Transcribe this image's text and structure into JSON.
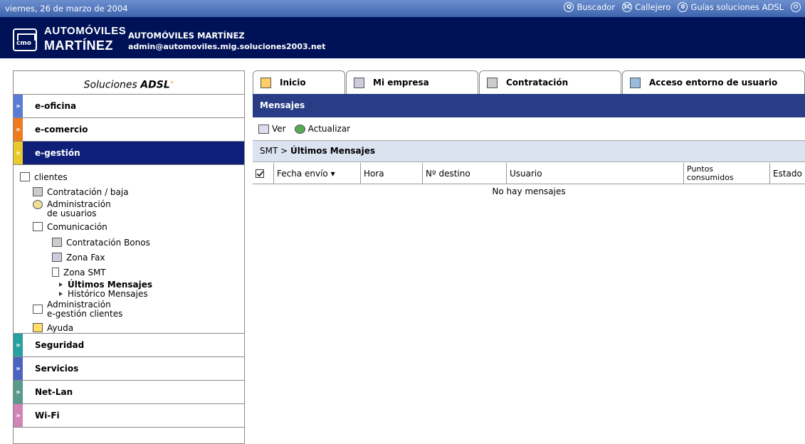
{
  "topbar": {
    "date": "viernes, 26 de marzo de 2004",
    "links": [
      {
        "label": "Buscador",
        "icon": "search-icon"
      },
      {
        "label": "Callejero",
        "icon": "map-icon"
      },
      {
        "label": "Guías soluciones ADSL",
        "icon": "guide-icon"
      }
    ],
    "power_icon": "power-icon"
  },
  "header": {
    "logo_line1": "AUTOMÓVILES",
    "logo_line2": "MARTÍNEZ",
    "logo_badge": "cmo",
    "company_name": "AUTOMÓVILES MARTÍNEZ",
    "company_email": "admin@automoviles.mig.soluciones2003.net"
  },
  "sidebar": {
    "title_prefix": "Soluciones ",
    "title_brand": "ADSL",
    "title_mark": "»",
    "sections_top": [
      {
        "label": "e-oficina",
        "color": "#5a7bd6"
      },
      {
        "label": "e-comercio",
        "color": "#f07a20"
      },
      {
        "label": "e-gestión",
        "color": "#e9c92c",
        "active": true
      }
    ],
    "tree": {
      "clientes": "clientes",
      "contratacion_baja": "Contratación / baja",
      "admin_usuarios_1": "Administración",
      "admin_usuarios_2": "de usuarios",
      "comunicacion": "Comunicación",
      "contratacion_bonos": "Contratación Bonos",
      "zona_fax": "Zona Fax",
      "zona_smt": "Zona SMT",
      "ultimos_mensajes": "Últimos Mensajes",
      "historico_mensajes": "Histórico Mensajes",
      "admin_gestion_1": "Administración",
      "admin_gestion_2": "e-gestión clientes",
      "ayuda": "Ayuda"
    },
    "sections_bottom": [
      {
        "label": "Seguridad",
        "color": "#27a0a0"
      },
      {
        "label": "Servicios",
        "color": "#4d63c2"
      },
      {
        "label": "Net-Lan",
        "color": "#5a9a8c"
      },
      {
        "label": "Wi-Fi",
        "color": "#d084b8"
      }
    ]
  },
  "tabs": [
    {
      "label": "Inicio"
    },
    {
      "label": "Mi empresa"
    },
    {
      "label": "Contratación"
    },
    {
      "label": "Acceso entorno de usuario"
    }
  ],
  "main": {
    "heading": "Mensajes",
    "toolbar": {
      "ver": "Ver",
      "actualizar": "Actualizar"
    },
    "breadcrumb_root": "SMT",
    "breadcrumb_sep": " > ",
    "breadcrumb_current": "Últimos Mensajes",
    "table": {
      "columns": [
        "Fecha envío ▾",
        "Hora",
        "Nº destino",
        "Usuario",
        "Puntos consumidos",
        "Estado"
      ],
      "col_puntos_1": "Puntos",
      "col_puntos_2": "consumidos",
      "empty_message": "No hay mensajes"
    }
  }
}
